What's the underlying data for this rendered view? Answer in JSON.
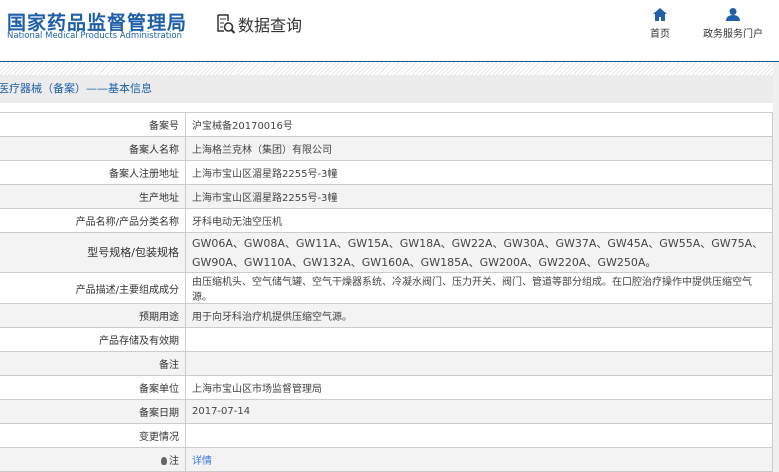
{
  "header": {
    "logo_cn": "国家药品监督管理局",
    "logo_en": "National Medical Products Administration",
    "section": "数据查询",
    "nav": [
      {
        "label": "首页",
        "icon": "home-icon"
      },
      {
        "label": "政务服务门户",
        "icon": "user-icon"
      }
    ]
  },
  "page_title": "医疗器械（备案）——基本信息",
  "rows": [
    {
      "label": "备案号",
      "value": "沪宝械备20170016号"
    },
    {
      "label": "备案人名称",
      "value": "上海格兰克林（集团）有限公司"
    },
    {
      "label": "备案人注册地址",
      "value": "上海市宝山区湄星路2255号-3幢"
    },
    {
      "label": "生产地址",
      "value": "上海市宝山区湄星路2255号-3幢"
    },
    {
      "label": "产品名称/产品分类名称",
      "value": "牙科电动无油空压机"
    },
    {
      "label": "型号规格/包装规格",
      "value": "GW06A、GW08A、GW11A、GW15A、GW18A、GW22A、GW30A、GW37A、GW45A、GW55A、GW75A、GW90A、GW110A、GW132A、GW160A、GW185A、GW200A、GW220A、GW250A。"
    },
    {
      "label": "产品描述/主要组成成分",
      "value": "由压缩机头、空气储气罐、空气干燥器系统、冷凝水阀门、压力开关、阀门、管道等部分组成。在口腔治疗操作中提供压缩空气源。"
    },
    {
      "label": "预期用途",
      "value": "用于向牙科治疗机提供压缩空气源。"
    },
    {
      "label": "产品存储及有效期",
      "value": ""
    },
    {
      "label": "备注",
      "value": ""
    },
    {
      "label": "备案单位",
      "value": "上海市宝山区市场监督管理局"
    },
    {
      "label": "备案日期",
      "value": "2017-07-14"
    },
    {
      "label": "变更情况",
      "value": ""
    },
    {
      "label": "注",
      "value": "详情"
    }
  ]
}
